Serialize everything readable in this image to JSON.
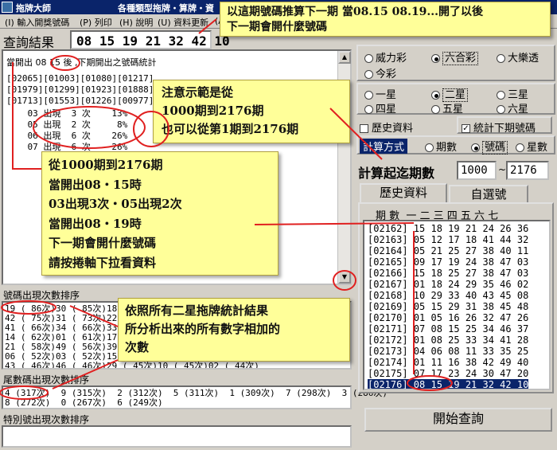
{
  "window": {
    "app_name": "拖牌大師",
    "title": "各種類型拖牌・算牌・資"
  },
  "menu": [
    "(I) 輸入開獎號碼",
    "(P) 列印",
    "(H) 說明",
    "(U) 資料更新",
    "(A)"
  ],
  "query": {
    "label": "查詢結果",
    "numbers": "08 15 19 21 32 42 10"
  },
  "result_lines": [
    "當開出 08 15 後 ,下期開出之號碼統計",
    "[02065][01003][01080][01217]",
    "[01979][01299][01923][01888]",
    "[01713][01553][01226][00977]",
    "    03 出現  3 次    13%",
    "    05 出現  2 次     8%",
    "    06 出現  6 次    26%",
    "    07 出現  6 次    26%"
  ],
  "panels": {
    "number_freq": {
      "title": "號碼出現次數排序",
      "lines": [
        "19 ( 86次)30 ( 85次)18",
        "42 ( 75次)31 ( 73次)22",
        "41 ( 66次)34 ( 66次)33",
        "14 ( 62次)01 ( 61次)17",
        "21 ( 58次)49 ( 56次)39",
        "06 ( 52次)03 ( 52次)15",
        "43 ( 46次)46 ( 46次)29 ( 45次)10 ( 45次)02 ( 44次)"
      ]
    },
    "tail_freq": {
      "title": "尾數碼出現次數排序",
      "lines": [
        "4 (317次)  9 (315次)  2 (312次)  5 (311次)  1 (309次)  7 (298次)  3 (286次)",
        "8 (272次)  0 (267次)  6 (249次)"
      ]
    },
    "special_freq": {
      "title": "特別號出現次數排序"
    }
  },
  "game_types": [
    "威力彩",
    "六合彩",
    "大樂透",
    "今彩"
  ],
  "game_selected": "六合彩",
  "star_types": [
    "一星",
    "二星",
    "三星",
    "四星",
    "五星",
    "六星"
  ],
  "star_selected": "二星",
  "history_checkbox": "歷史資料",
  "stats_checkbox": "統計下期號碼",
  "calc_mode": {
    "label": "計算方式",
    "options": [
      "期數",
      "號碼",
      "星數"
    ],
    "selected": "號碼"
  },
  "period_range": {
    "label": "計算起迄期數",
    "from": "1000",
    "sep": "~",
    "to": "2176"
  },
  "tabs": [
    "歷史資料",
    "自選號"
  ],
  "history": {
    "header": "期 數  一 二 三 四 五 六 七",
    "rows": [
      "[02162] 15 18 19 21 24 26 36",
      "[02163] 05 12 17 18 41 44 32",
      "[02164] 05 21 25 27 38 40 11",
      "[02165] 09 17 19 24 38 47 03",
      "[02166] 15 18 25 27 38 47 03",
      "[02167] 01 18 24 29 35 46 02",
      "[02168] 10 29 33 40 43 45 08",
      "[02169] 05 15 29 31 38 45 48",
      "[02170] 01 05 16 26 32 47 26",
      "[02171] 07 08 15 25 34 46 37",
      "[02172] 01 08 25 33 34 41 28",
      "[02173] 04 06 08 11 33 35 25",
      "[02174] 01 11 16 38 42 49 40",
      "[02175] 07 17 23 24 30 47 20",
      "[02176] 08 15 19 21 32 42 10"
    ]
  },
  "start_button": "開始查詢",
  "notes": {
    "top": [
      "以這期號碼推算下一期 當08.15 08.19...開了以後",
      "下一期會開什麼號碼"
    ],
    "range": [
      "注意示範是從",
      "1000期到2176期",
      "也可以從第1期到2176期"
    ],
    "main": [
      "從1000期到2176期",
      "當開出08・15時",
      "03出現3次・05出現2次",
      "當開出08・19時",
      "下一期會開什麼號碼",
      "請按捲軸下拉看資料"
    ],
    "bottom": [
      "依照所有二星拖牌統計結果",
      "所分析出來的所有數字相加的",
      "次數"
    ]
  }
}
